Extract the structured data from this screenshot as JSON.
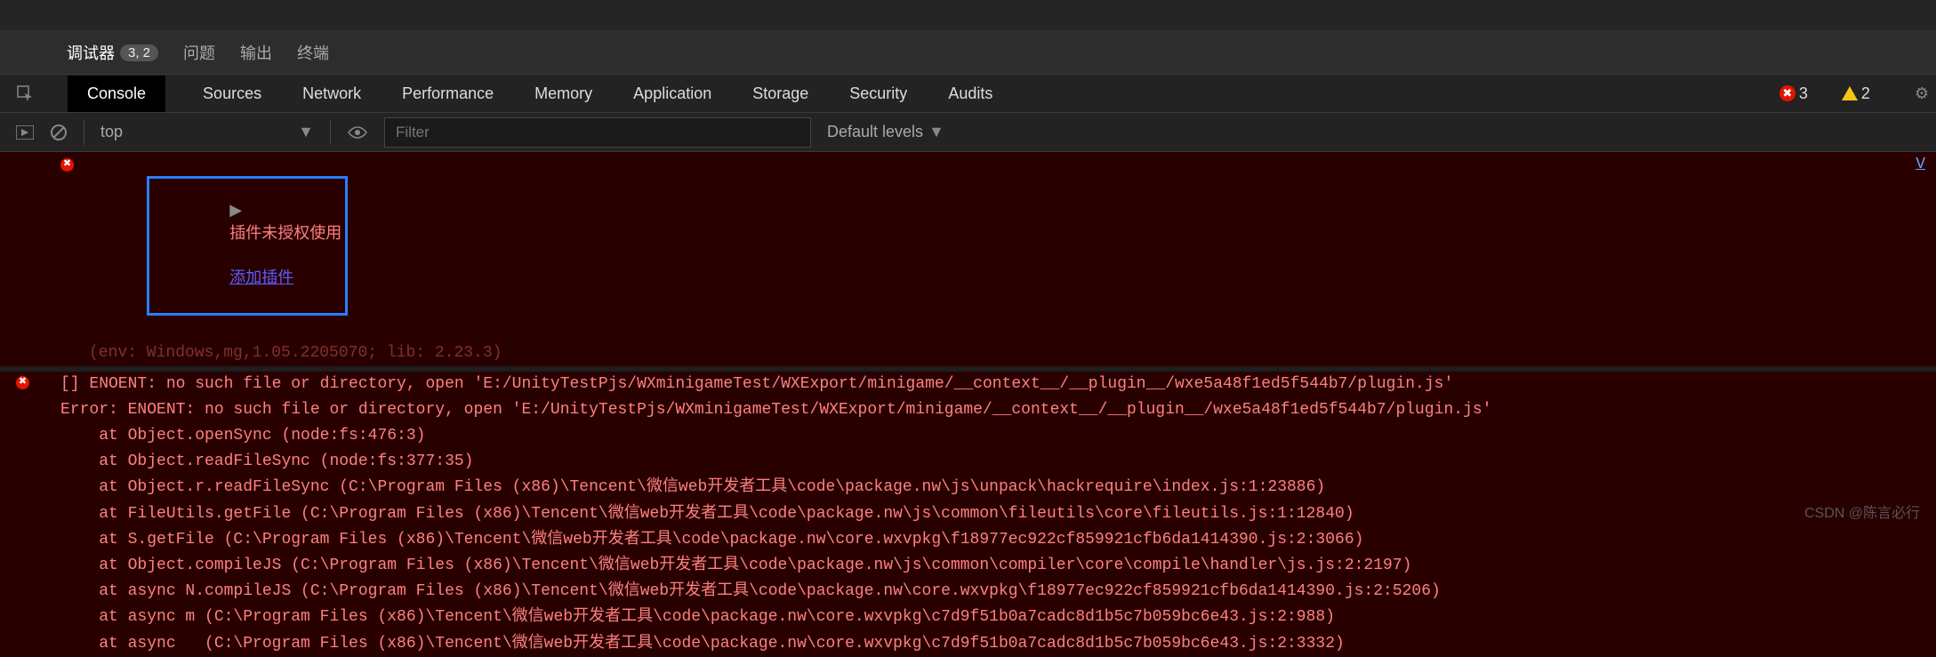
{
  "topTabs": {
    "debugger": {
      "label": "调试器",
      "badge": "3, 2"
    },
    "issues": "问题",
    "output": "输出",
    "terminal": "终端"
  },
  "devtoolsTabs": {
    "console": "Console",
    "sources": "Sources",
    "network": "Network",
    "performance": "Performance",
    "memory": "Memory",
    "application": "Application",
    "storage": "Storage",
    "security": "Security",
    "audits": "Audits"
  },
  "indicators": {
    "errorCount": "3",
    "warnCount": "2"
  },
  "filterBar": {
    "context": "top",
    "filterPlaceholder": "Filter",
    "levels": "Default levels"
  },
  "console": {
    "pluginWarn": {
      "text": "插件未授权使用",
      "link": "添加插件"
    },
    "envLine": "(env: Windows,mg,1.05.2205070; lib: 2.23.3)",
    "rightLink": "V",
    "errorHeader": "[] ENOENT: no such file or directory, open 'E:/UnityTestPjs/WXminigameTest/WXExport/minigame/__context__/__plugin__/wxe5a48f1ed5f544b7/plugin.js'",
    "errorLine2": "Error: ENOENT: no such file or directory, open 'E:/UnityTestPjs/WXminigameTest/WXExport/minigame/__context__/__plugin__/wxe5a48f1ed5f544b7/plugin.js'",
    "stack": [
      "    at Object.openSync (node:fs:476:3)",
      "    at Object.readFileSync (node:fs:377:35)",
      "    at Object.r.readFileSync (C:\\Program Files (x86)\\Tencent\\微信web开发者工具\\code\\package.nw\\js\\unpack\\hackrequire\\index.js:1:23886)",
      "    at FileUtils.getFile (C:\\Program Files (x86)\\Tencent\\微信web开发者工具\\code\\package.nw\\js\\common\\fileutils\\core\\fileutils.js:1:12840)",
      "    at S.getFile (C:\\Program Files (x86)\\Tencent\\微信web开发者工具\\code\\package.nw\\core.wxvpkg\\f18977ec922cf859921cfb6da1414390.js:2:3066)",
      "    at Object.compileJS (C:\\Program Files (x86)\\Tencent\\微信web开发者工具\\code\\package.nw\\js\\common\\compiler\\core\\compile\\handler\\js.js:2:2197)",
      "    at async N.compileJS (C:\\Program Files (x86)\\Tencent\\微信web开发者工具\\code\\package.nw\\core.wxvpkg\\f18977ec922cf859921cfb6da1414390.js:2:5206)",
      "    at async m (C:\\Program Files (x86)\\Tencent\\微信web开发者工具\\code\\package.nw\\core.wxvpkg\\c7d9f51b0a7cadc8d1b5c7b059bc6e43.js:2:988)",
      "    at async   (C:\\Program Files (x86)\\Tencent\\微信web开发者工具\\code\\package.nw\\core.wxvpkg\\c7d9f51b0a7cadc8d1b5c7b059bc6e43.js:2:3332)"
    ]
  },
  "watermark": "CSDN @陈言必行"
}
